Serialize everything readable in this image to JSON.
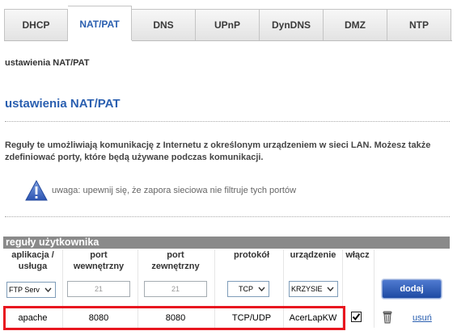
{
  "tabs": [
    {
      "label": "DHCP",
      "active": false
    },
    {
      "label": "NAT/PAT",
      "active": true
    },
    {
      "label": "DNS",
      "active": false
    },
    {
      "label": "UPnP",
      "active": false
    },
    {
      "label": "DynDNS",
      "active": false
    },
    {
      "label": "DMZ",
      "active": false
    },
    {
      "label": "NTP",
      "active": false
    }
  ],
  "breadcrumb": "ustawienia NAT/PAT",
  "page_title": "ustawienia NAT/PAT",
  "description": "Reguły te umożliwiają komunikację z Internetu z określonym urządzeniem w sieci LAN. Możesz także zdefiniować porty, które będą używane podczas komunikacji.",
  "warning": {
    "icon": "warning-triangle-icon",
    "text": "uwaga: upewnij się, że zapora sieciowa nie filtruje tych portów"
  },
  "rules": {
    "header": "reguły użytkownika",
    "columns": {
      "app": "aplikacja / usługa",
      "internal_port": "port wewnętrzny",
      "external_port": "port zewnętrzny",
      "protocol": "protokół",
      "device": "urządzenie",
      "enable": "włącz"
    },
    "new_rule": {
      "app_value": "FTP Serv",
      "internal_port_placeholder": "21",
      "external_port_placeholder": "21",
      "protocol_value": "TCP",
      "device_value": "KRZYSIE",
      "add_label": "dodaj"
    },
    "entries": [
      {
        "app": "apache",
        "internal_port": "8080",
        "external_port": "8080",
        "protocol": "TCP/UDP",
        "device": "AcerLapKW",
        "enabled": true,
        "delete_label": "usuń"
      }
    ]
  },
  "colors": {
    "accent": "#2a5fb0",
    "highlight": "#e8161f",
    "header_bar": "#8a8a8a"
  }
}
